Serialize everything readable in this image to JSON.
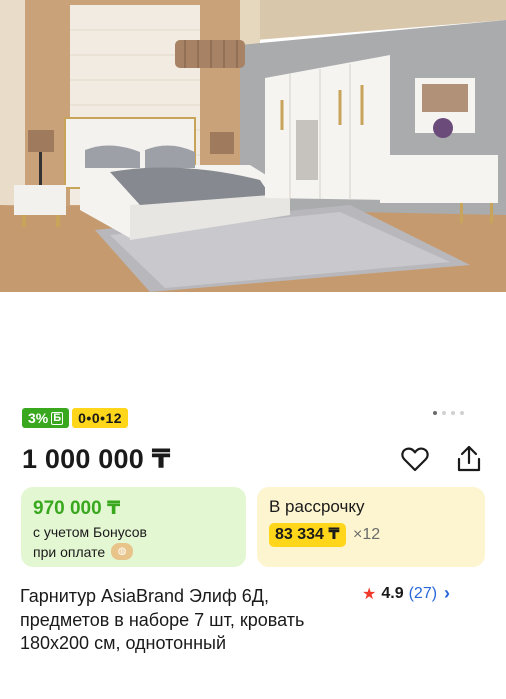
{
  "product_image": {
    "alt": "bedroom-set-photo"
  },
  "badges": {
    "bonus_label": "3%",
    "bonus_glyph": "Б",
    "installment_label": "0•0•12"
  },
  "pager": {
    "count": 4,
    "active_index": 0
  },
  "price": {
    "value": "1 000 000 ₸"
  },
  "actions": {
    "favorite_icon": "heart-icon",
    "share_icon": "share-icon"
  },
  "bonus_card": {
    "price": "970 000 ₸",
    "line1": "с учетом Бонусов",
    "line2": "при оплате",
    "accent_color": "#3aa81f",
    "background": "#e4f7d3"
  },
  "installment_card": {
    "title": "В рассрочку",
    "monthly": "83 334 ₸",
    "multiplier": "×12",
    "pill_color": "#ffd619",
    "background": "#fdf5d0"
  },
  "product": {
    "title": "Гарнитур AsiaBrand Элиф 6Д, предметов в наборе 7 шт, кровать 180x200 см, однотонный"
  },
  "rating": {
    "value": "4.9",
    "count": "(27)",
    "star_color": "#f0392b",
    "link_color": "#2867d9"
  }
}
